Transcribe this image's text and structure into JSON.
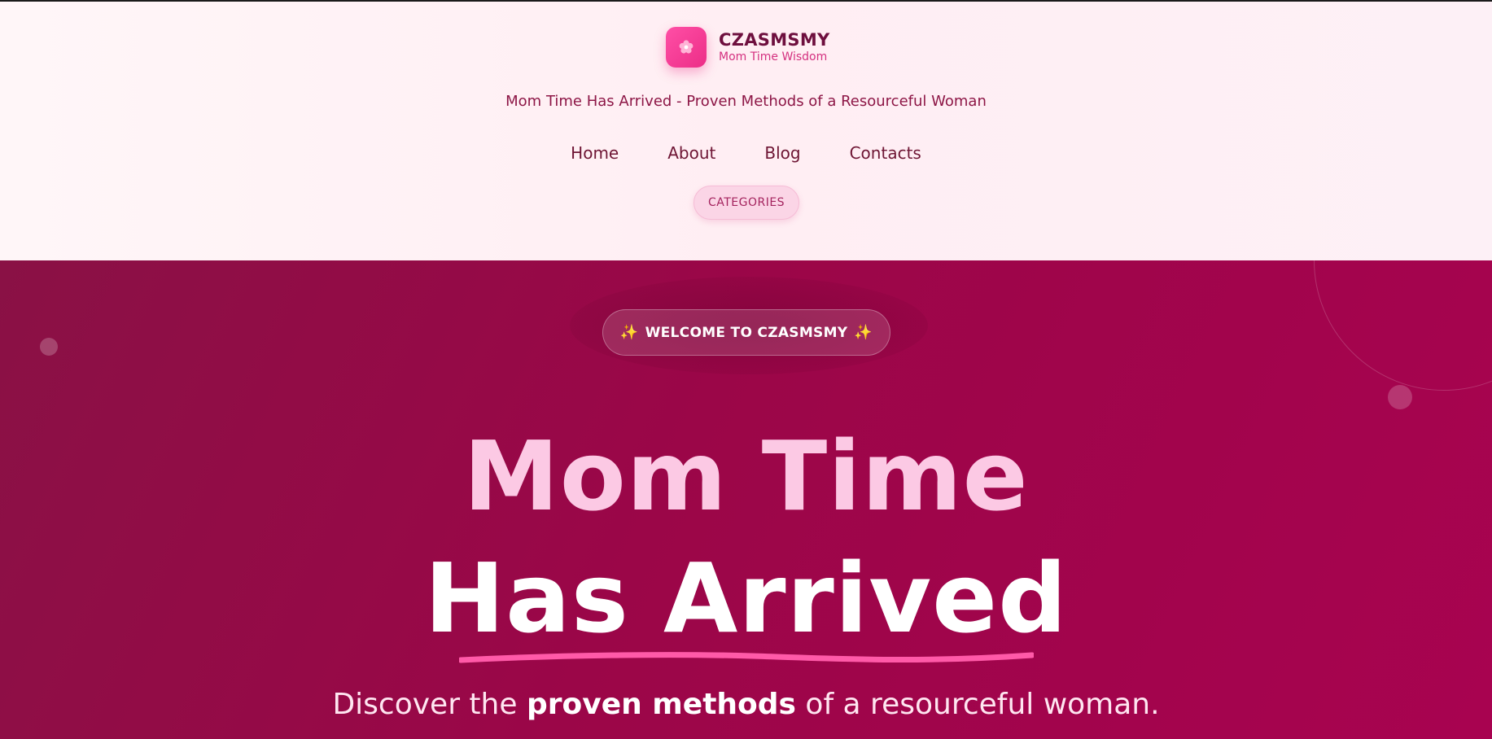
{
  "brand": {
    "name": "CZASMSMY",
    "tagline": "Mom Time Wisdom",
    "logo_icon": "flower-icon"
  },
  "header": {
    "subtitle": "Mom Time Has Arrived - Proven Methods of a Resourceful Woman",
    "nav": [
      {
        "label": "Home"
      },
      {
        "label": "About"
      },
      {
        "label": "Blog"
      },
      {
        "label": "Contacts"
      }
    ],
    "categories_label": "CATEGORIES"
  },
  "hero": {
    "badge_label": "WELCOME TO CZASMSMY",
    "badge_icon": "sparkles-icon",
    "title_line1": "Mom Time",
    "title_line2": "Has Arrived",
    "sub_pre": "Discover the ",
    "sub_bold": "proven methods",
    "sub_post": " of a resourceful woman."
  },
  "colors": {
    "accent": "#ec2d87",
    "hero_bg": "#9b0648",
    "title_pink": "#fcc9e4",
    "underline": "#ff5aa8"
  }
}
